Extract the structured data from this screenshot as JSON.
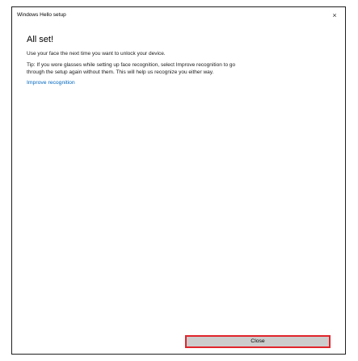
{
  "window": {
    "title": "Windows Hello setup",
    "close_glyph": "×"
  },
  "main": {
    "heading": "All set!",
    "message": "Use your face the next time you want to unlock your device.",
    "tip_line1": "Tip: If you wore glasses while setting up face recognition, select Improve recognition to go",
    "tip_line2": "through the setup again without them. This will help us recognize you either way.",
    "improve_link": "Improve recognition"
  },
  "footer": {
    "close_label": "Close"
  },
  "colors": {
    "link": "#0067c0",
    "button_bg": "#cccccc",
    "highlight_border": "#e0252b"
  },
  "icons": {
    "close": "close-icon"
  }
}
